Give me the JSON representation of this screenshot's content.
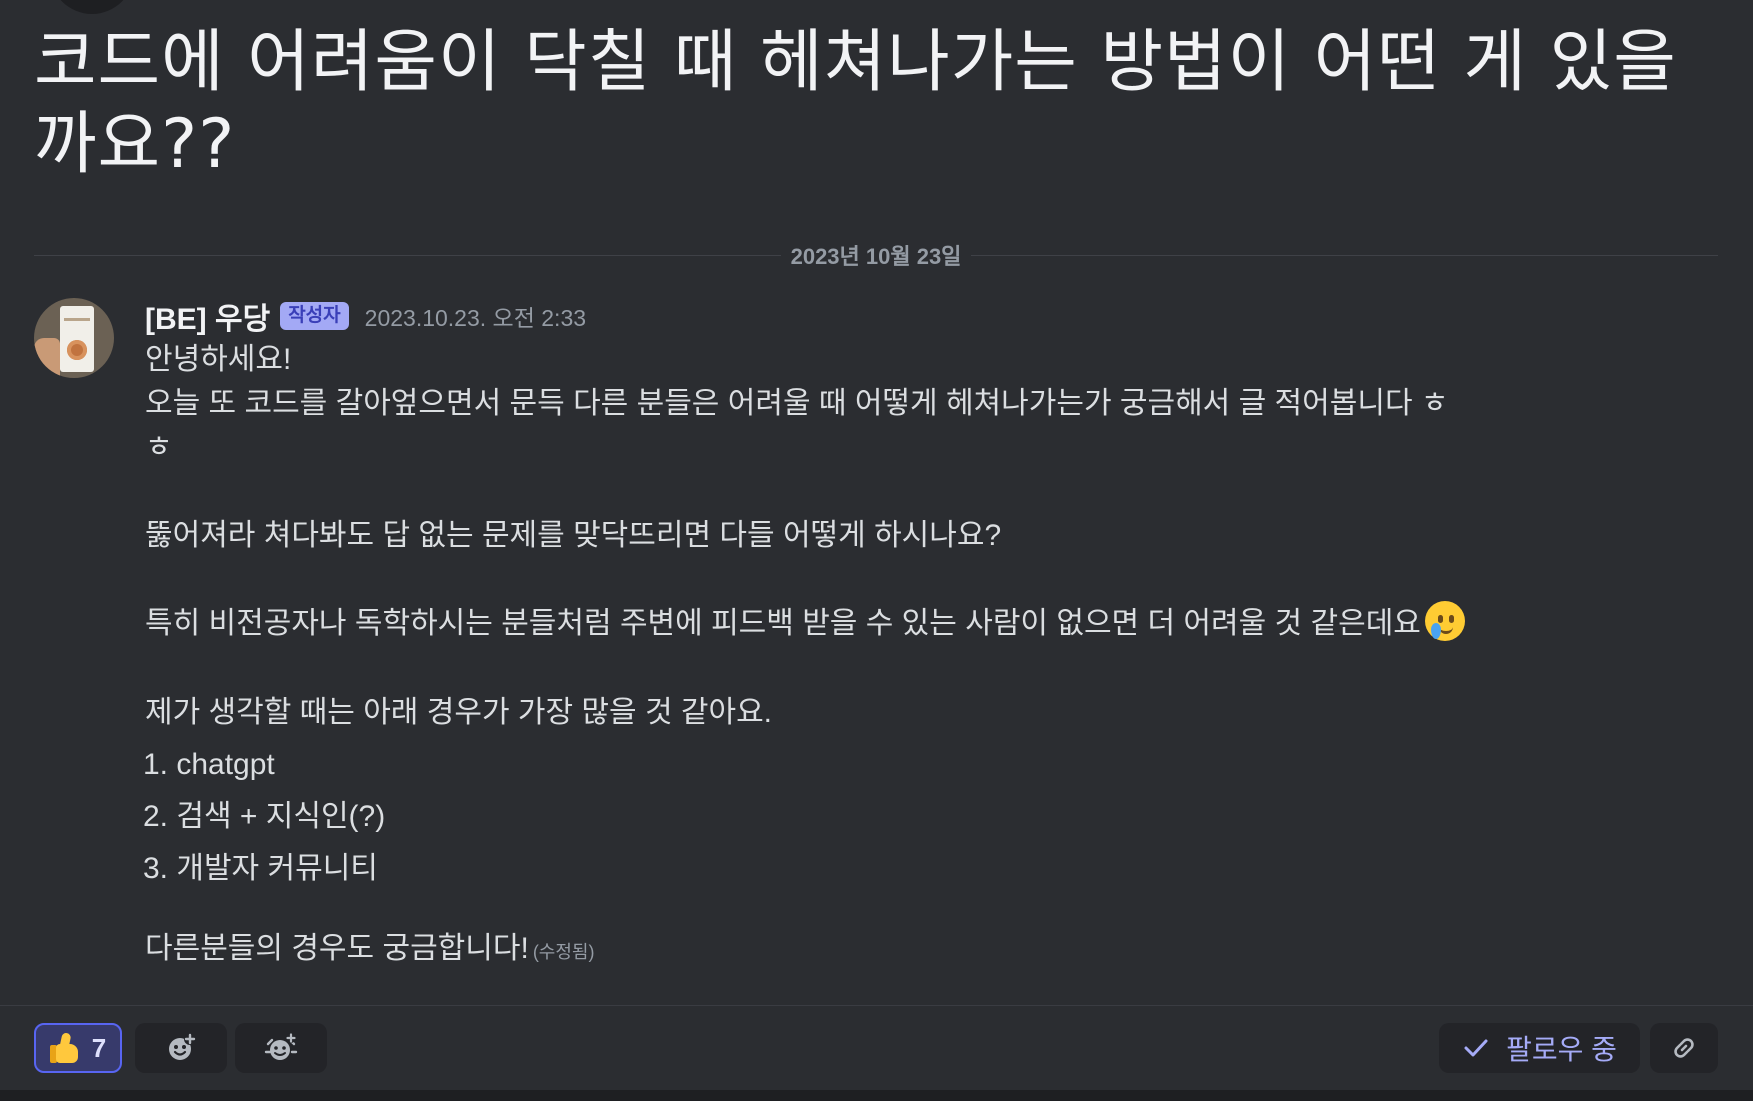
{
  "post": {
    "title": "코드에 어려움이 닥칠 때 헤쳐나가는 방법이 어떤 게 있을까요??",
    "date_divider": "2023년 10월 23일"
  },
  "message": {
    "author": "[BE] 우당",
    "author_badge": "작성자",
    "timestamp": "2023.10.23. 오전 2:33",
    "lines": {
      "greeting": "안녕하세요!",
      "intro": "오늘 또 코드를 갈아엎으면서 문득 다른 분들은 어려울 때 어떻게 헤쳐나가는가 궁금해서 글 적어봅니다 ㅎ",
      "intro_tail": "ㅎ",
      "question": "뚫어져라 쳐다봐도 답 없는 문제를 맞닥뜨리면 다들 어떻게 하시나요?",
      "concern": "특히 비전공자나 독학하시는 분들처럼 주변에 피드백 받을 수 있는 사람이 없으면 더 어려울 것 같은데요",
      "list_intro": "제가 생각할 때는 아래 경우가 가장 많을 것 같아요.",
      "list": [
        "1. chatgpt",
        "2. 검색 + 지식인(?)",
        "3. 개발자 커뮤니티"
      ],
      "closing": "다른분들의 경우도 궁금합니다!",
      "edited": "(수정됨)"
    },
    "emoji": "face-holding-back-tears"
  },
  "footer": {
    "reaction": {
      "emoji": "thumbs-up",
      "count": "7"
    },
    "follow_label": "팔로우 중",
    "icons": [
      "add-reaction-icon",
      "super-reaction-icon",
      "check-icon",
      "link-icon"
    ]
  },
  "colors": {
    "background": "#2b2d31",
    "accent": "#5865f2",
    "badge": "#a3a9f5",
    "muted_text": "#949ba4",
    "body_text": "#dbdee1"
  }
}
